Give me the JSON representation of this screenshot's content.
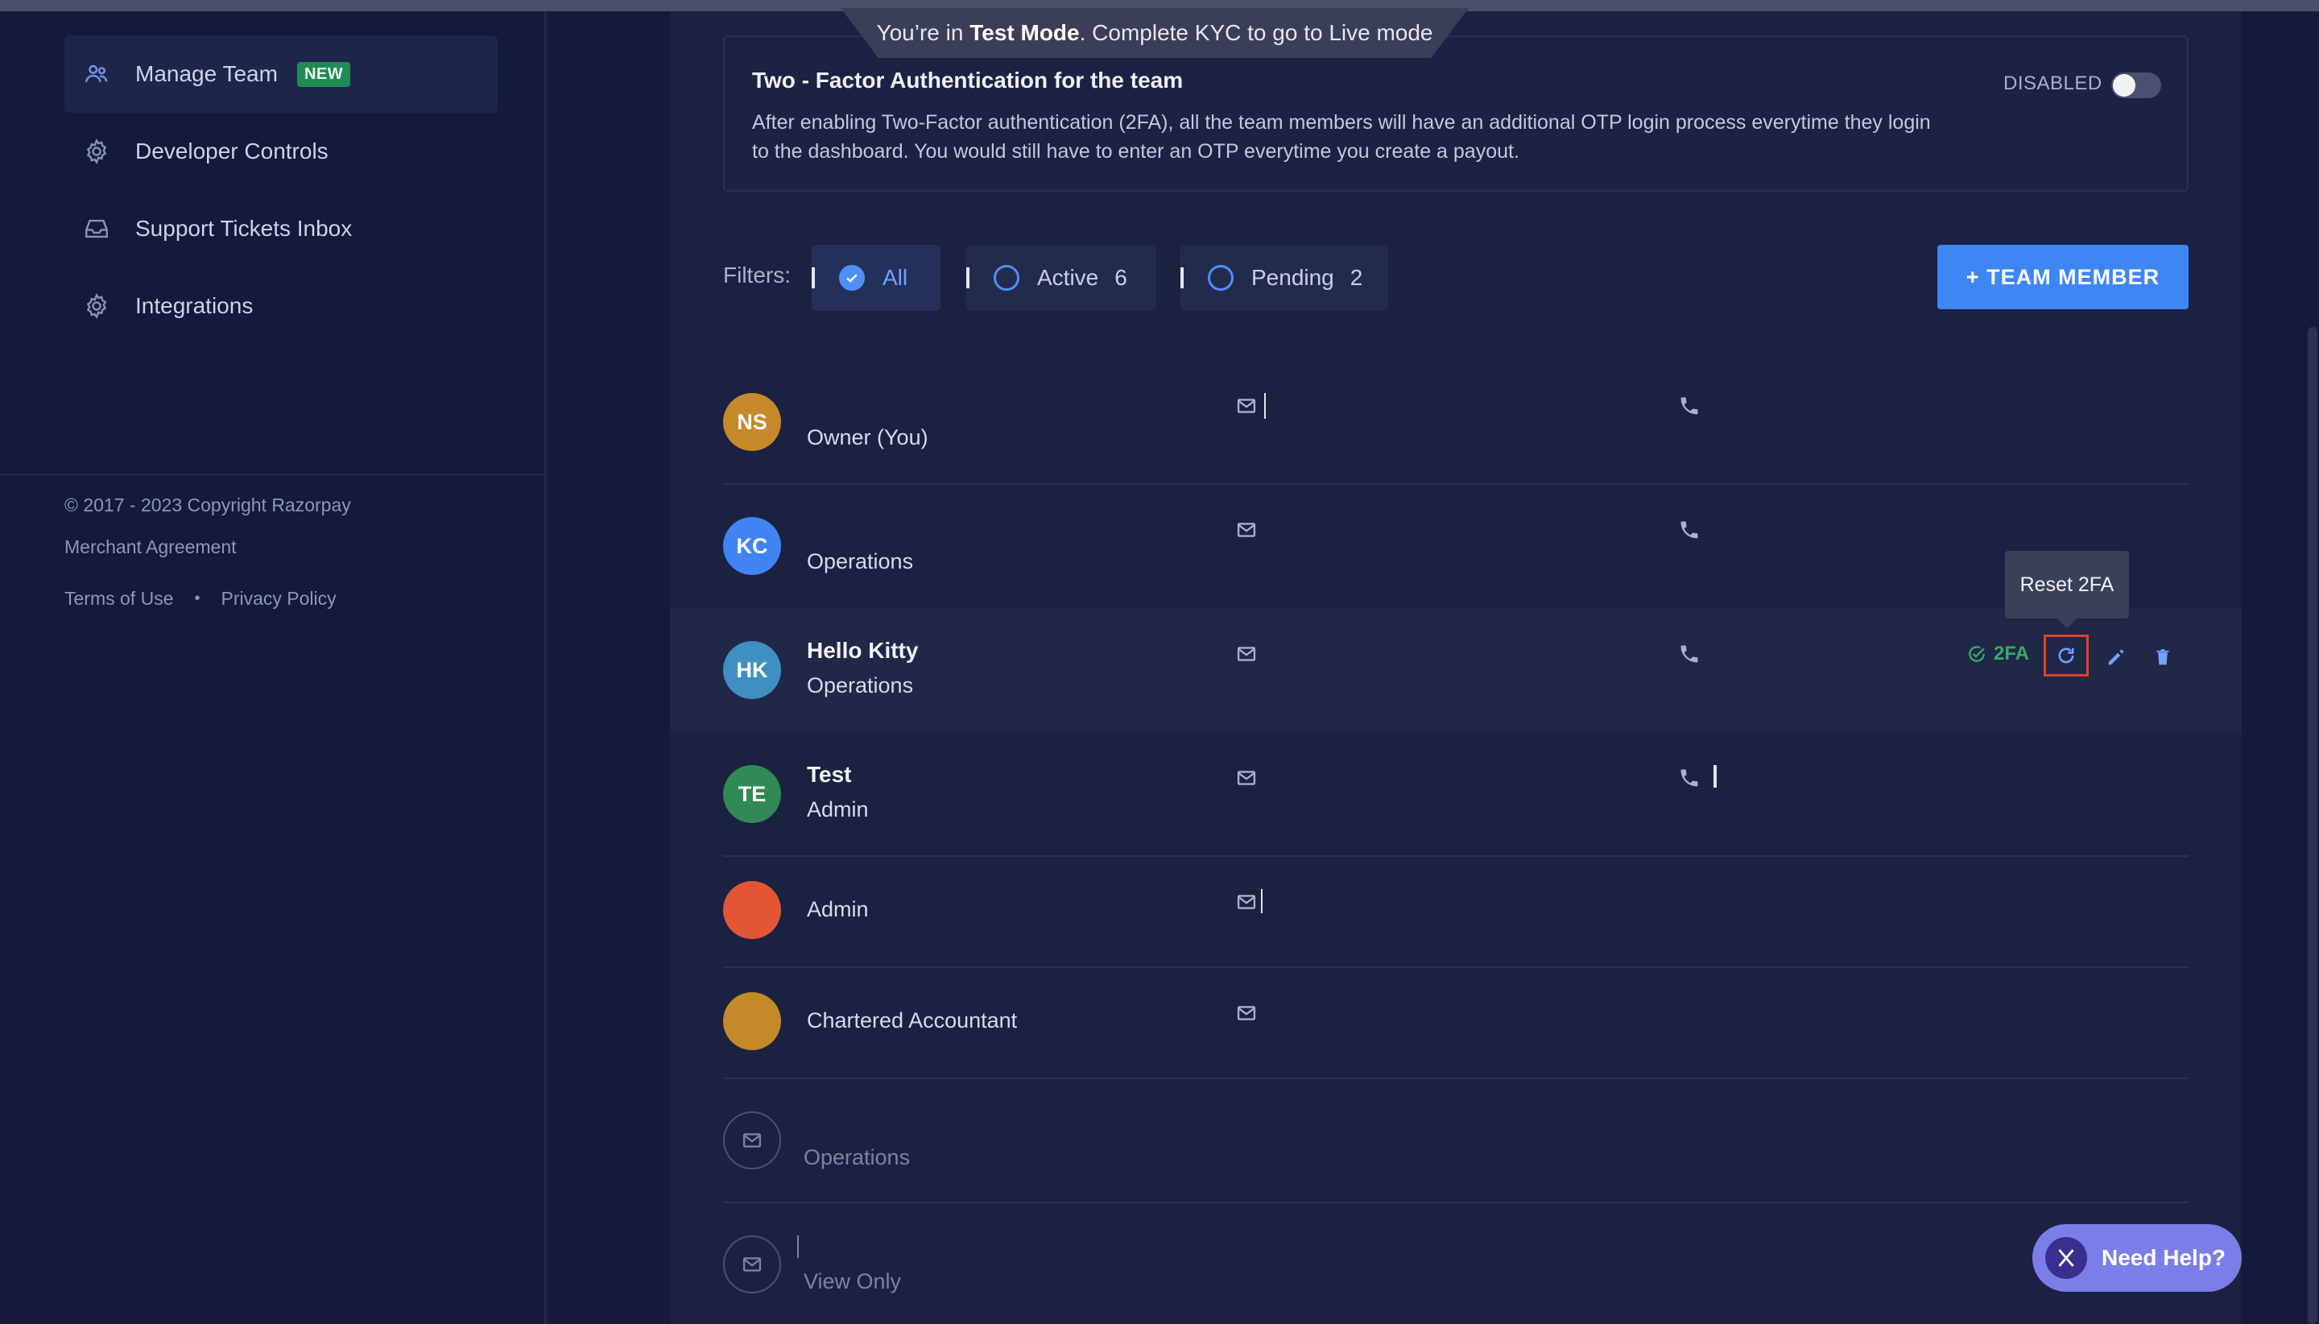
{
  "banner": {
    "prefix": "You’re in ",
    "mode": "Test Mode",
    "suffix": ". Complete KYC to go to Live mode"
  },
  "sidebar": {
    "items": [
      {
        "label": "Manage Team",
        "badge": "NEW",
        "icon": "team-icon"
      },
      {
        "label": "Developer Controls",
        "icon": "gear-icon"
      },
      {
        "label": "Support Tickets Inbox",
        "icon": "inbox-icon"
      },
      {
        "label": "Integrations",
        "icon": "gear-icon"
      }
    ],
    "footer": {
      "copyright": "© 2017 - 2023 Copyright Razorpay",
      "merchant_agreement": "Merchant Agreement",
      "terms": "Terms of Use",
      "separator": "•",
      "privacy": "Privacy Policy"
    }
  },
  "twofa": {
    "title": "Two - Factor Authentication for the team",
    "description": "After enabling Two-Factor authentication (2FA), all the team members will have an additional OTP login process everytime they login to the dashboard. You would still have to enter an OTP everytime you create a payout.",
    "status": "DISABLED",
    "enabled": false
  },
  "filters": {
    "label": "Filters:",
    "options": [
      {
        "label": "All",
        "count": "",
        "selected": true
      },
      {
        "label": "Active",
        "count": "6",
        "selected": false
      },
      {
        "label": "Pending",
        "count": "2",
        "selected": false
      }
    ]
  },
  "add_button": "+ TEAM MEMBER",
  "members": [
    {
      "initials": "NS",
      "name": "",
      "role": "Owner (You)",
      "color": "#c5892a"
    },
    {
      "initials": "KC",
      "name": "",
      "role": "Operations",
      "color": "#3f84f2"
    },
    {
      "initials": "HK",
      "name": "Hello Kitty",
      "role": "Operations",
      "color": "#3f8fc2",
      "twofa": "2FA"
    },
    {
      "initials": "TE",
      "name": "Test",
      "role": "Admin",
      "color": "#2f8a55"
    },
    {
      "initials": "",
      "name": "",
      "role": "Admin",
      "color": "#e25636"
    },
    {
      "initials": "",
      "name": "",
      "role": "Chartered Accountant",
      "color": "#c5892a"
    },
    {
      "initials": "",
      "name": "",
      "role": "Operations",
      "pending": true
    },
    {
      "initials": "",
      "name": "",
      "role": "View Only",
      "pending": true
    }
  ],
  "tooltip": "Reset 2FA",
  "help": "Need Help?",
  "colors": {
    "accent": "#3d86f4",
    "success": "#39a86a",
    "focus": "#e0422a"
  }
}
